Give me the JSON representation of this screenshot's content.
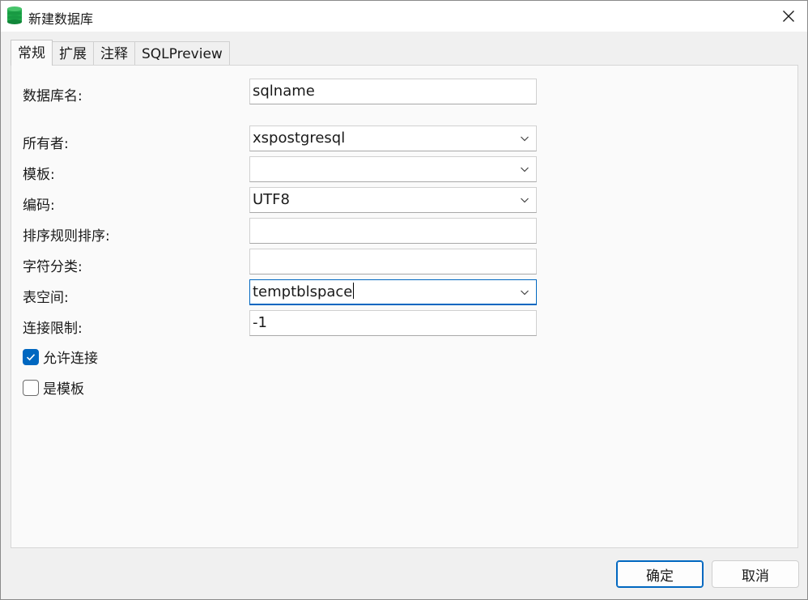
{
  "window": {
    "title": "新建数据库"
  },
  "tabs": [
    {
      "label": "常规",
      "active": true
    },
    {
      "label": "扩展"
    },
    {
      "label": "注释"
    },
    {
      "label": "SQLPreview"
    }
  ],
  "form": {
    "db_name": {
      "label": "数据库名:",
      "value": "sqlname"
    },
    "owner": {
      "label": "所有者:",
      "value": "xspostgresql"
    },
    "template": {
      "label": "模板:",
      "value": ""
    },
    "encoding": {
      "label": "编码:",
      "value": "UTF8"
    },
    "collation": {
      "label": "排序规则排序:",
      "value": ""
    },
    "ctype": {
      "label": "字符分类:",
      "value": ""
    },
    "tablespace": {
      "label": "表空间:",
      "value": "temptblspace"
    },
    "conn_limit": {
      "label": "连接限制:",
      "value": "-1"
    },
    "allow_conn": {
      "label": "允许连接",
      "checked": true
    },
    "is_template": {
      "label": "是模板",
      "checked": false
    }
  },
  "buttons": {
    "ok": "确定",
    "cancel": "取消"
  },
  "colors": {
    "accent": "#0067c0",
    "db_icon": "#1fa84a"
  }
}
